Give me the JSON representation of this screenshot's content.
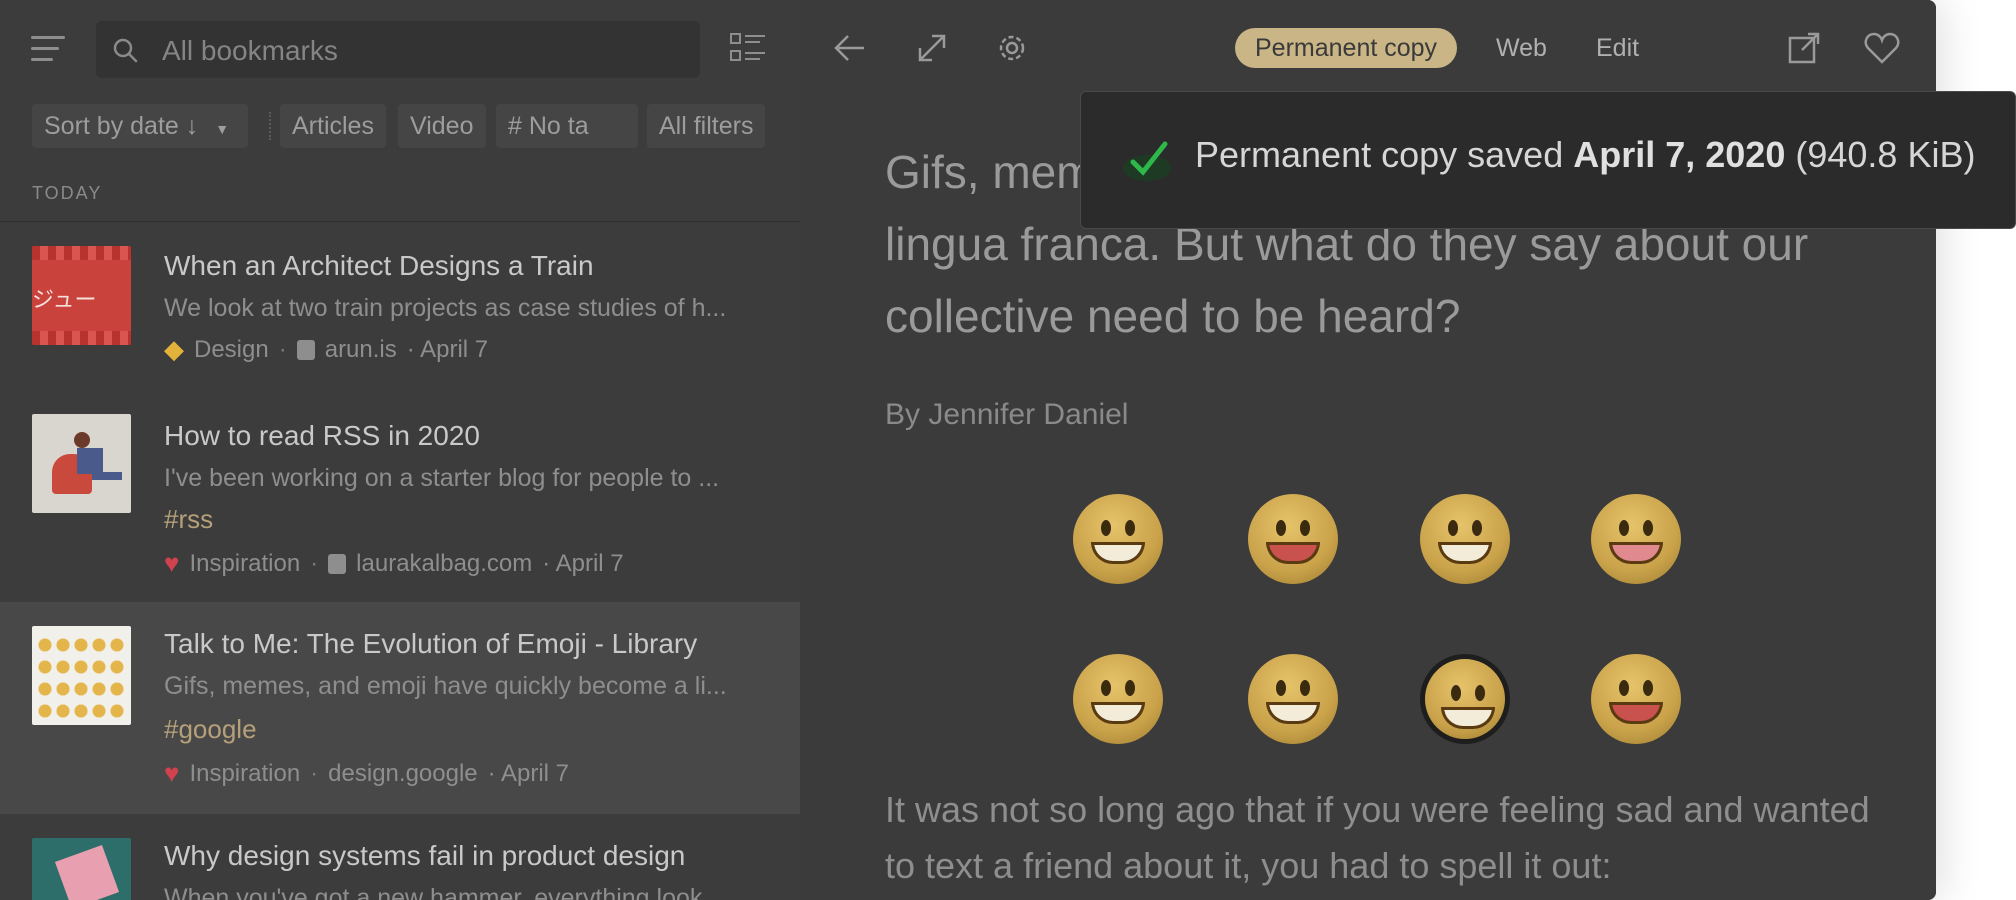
{
  "search": {
    "placeholder": "All bookmarks"
  },
  "filters": {
    "sort": "Sort by date ↓",
    "articles": "Articles",
    "video": "Video",
    "no_tags": "# No ta",
    "all_filters": "All filters"
  },
  "section": "TODAY",
  "bookmarks": [
    {
      "title": "When an Architect Designs a Train",
      "excerpt": "We look at two train projects as case studies of h...",
      "collection": "Design",
      "domain": "arun.is",
      "date": "· April 7",
      "thumb_text": "ジュー"
    },
    {
      "title": "How to read RSS in 2020",
      "excerpt": "I've been working on a starter blog for people to ...",
      "tag": "rss",
      "collection": "Inspiration",
      "domain": "laurakalbag.com",
      "date": "· April 7"
    },
    {
      "title": "Talk to Me: The Evolution of Emoji - Library",
      "excerpt": "Gifs, memes, and emoji have quickly become a li...",
      "tag": "google",
      "collection": "Inspiration",
      "domain": "design.google",
      "date": "· April 7"
    },
    {
      "title": "Why design systems fail in product design",
      "excerpt": "When you've got a new hammer, everything look..."
    }
  ],
  "toolbar": {
    "permanent_copy": "Permanent copy",
    "web": "Web",
    "edit": "Edit"
  },
  "article": {
    "headline": "Gifs, memes, and emoji have quickly become a lingua franca. But what do they say about our collective need to be heard?",
    "byline": "By Jennifer Daniel",
    "body": "It was not so long ago that if you were feeling sad and wanted to text a friend about it, you had to spell it out:"
  },
  "toast": {
    "prefix": "Permanent copy saved",
    "date": "April 7, 2020",
    "size": "(940.8 KiB)"
  },
  "colors": {
    "accent": "#c9b586",
    "tag": "#b5a07a",
    "check": "#2fb84a"
  }
}
